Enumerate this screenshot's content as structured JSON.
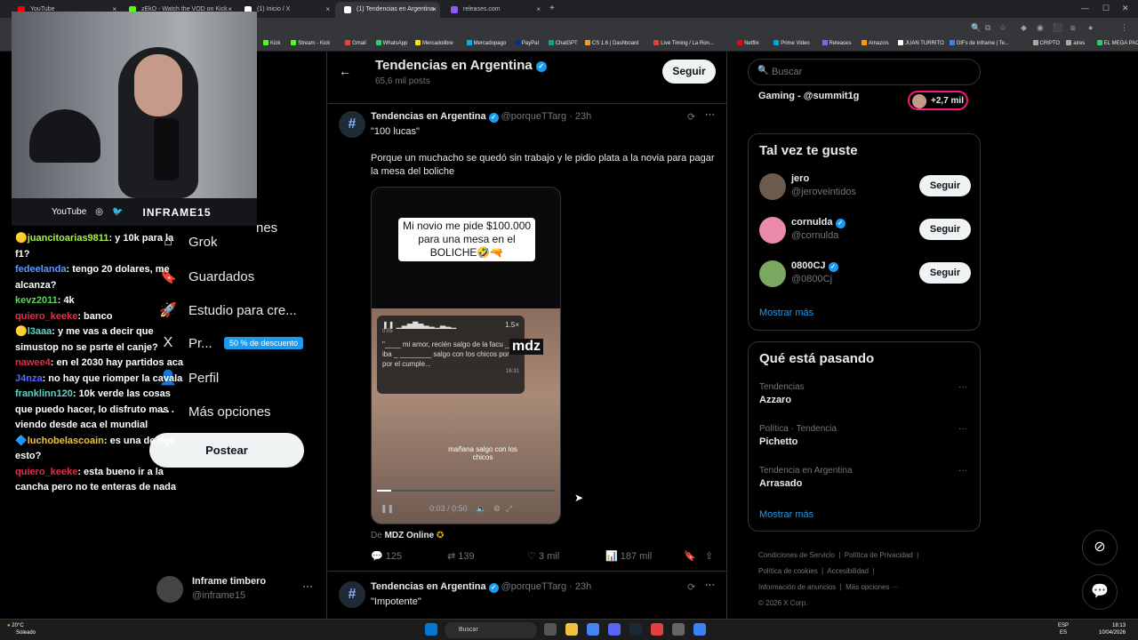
{
  "browser": {
    "tabs": [
      {
        "label": "YouTube",
        "color": "#ff0000"
      },
      {
        "label": "zEkO - Watch the VOD on Kick",
        "color": "#53fc18"
      },
      {
        "label": "(1) Inicio / X",
        "color": "#ffffff"
      },
      {
        "label": "(1) Tendencias en Argentina",
        "color": "#ffffff"
      },
      {
        "label": "releases.com",
        "color": "#8b5cf6"
      }
    ],
    "bookmarks": [
      "Kick",
      "Stream - Kick",
      "Gmail",
      "WhatsApp",
      "Mercadolibre",
      "Mercadopago",
      "PayPal",
      "ChatGPT",
      "CS 1.6 | Dashboard",
      "Live Timing / La Ron...",
      "Netflix",
      "Prime Video",
      "Releases",
      "Amazon.",
      "JUAN TURRITO",
      "GIFs de Inframe | Te...",
      "CRIPTO",
      "aires",
      "EL MEGA PACK PAR..."
    ]
  },
  "stream_overlay": {
    "socials": [
      "YouTube",
      "◎",
      "🐦"
    ],
    "brand": "INFRAME15"
  },
  "chat": [
    {
      "badge": "🟡",
      "user": "juancitoarias9811",
      "color": "#a7f046",
      "text": ": y 10k para la f1?"
    },
    {
      "badge": "",
      "user": "fedeelanda",
      "color": "#5b9bff",
      "text": ": tengo 20 dolares, me alcanza?"
    },
    {
      "badge": "",
      "user": "kevz2011",
      "color": "#5ad85a",
      "text": ": 4k"
    },
    {
      "badge": "",
      "user": "quiero_keeke",
      "color": "#e0304a",
      "text": ": banco"
    },
    {
      "badge": "🟡",
      "user": "l3aaa",
      "color": "#5ad8c8",
      "text": ": y me vas a decir que simustop no se psrte el canje?"
    },
    {
      "badge": "",
      "user": "nawee4",
      "color": "#e0304a",
      "text": ": en el 2030 hay partidos aca"
    },
    {
      "badge": "",
      "user": "J4nza",
      "color": "#5b6bff",
      "text": ": no hay que riomper la cavala"
    },
    {
      "badge": "",
      "user": "franklinn120",
      "color": "#5ad8c8",
      "text": ": 10k verde las cosas que puedo hacer, lo disfruto mas viendo desde aca el mundial"
    },
    {
      "badge": "🔷",
      "user": "luchobelascoain",
      "color": "#f0c040",
      "text": ": es una de dgo esto?"
    },
    {
      "badge": "",
      "user": "quiero_keeke",
      "color": "#e0304a",
      "text": ": esta bueno ir a la cancha pero no te enteras de nada"
    }
  ],
  "leftnav": {
    "items": [
      {
        "icon": "⌂",
        "label": "Grok"
      },
      {
        "icon": "🔖",
        "label": "Guardados"
      },
      {
        "icon": "🚀",
        "label": "Estudio para cre..."
      },
      {
        "icon": "X",
        "label": "Pr..."
      },
      {
        "icon": "👤",
        "label": "Perfil"
      },
      {
        "icon": "⋯",
        "label": "Más opciones"
      }
    ],
    "partial_label": "nes",
    "premium_badge": "50 % de descuento",
    "post_label": "Postear",
    "account": {
      "name": "Inframe timbero",
      "handle": "@inframe15"
    }
  },
  "main": {
    "title": "Tendencias en Argentina",
    "subtitle": "65,6 mil posts",
    "follow_label": "Seguir",
    "tweet1": {
      "name": "Tendencias en Argentina",
      "meta": "@porqueTTarg · 23h",
      "title": "\"100 lucas\"",
      "body": "Porque un muchacho se quedó sin trabajo y le pidio plata a la novia para pagar la mesa del boliche",
      "media_caption": "Mi novio me pide $100.000 para una mesa en el BOLICHE🤣🔫",
      "audio_speed": "1.5×",
      "audio_time": "0:05",
      "audio_text": "\"____ mi amor, recién salgo de la facu __ iba _ ________ salgo con los chicos por por el cumple...",
      "audio_time2": "16:31",
      "mdz": "mdz",
      "video_sub": "mañana salgo con los chicos",
      "video_time": "0:03 / 0:50",
      "progress": 0.08,
      "source_prefix": "De",
      "source": "MDZ Online",
      "stats": {
        "replies": "125",
        "reposts": "139",
        "likes": "3 mil",
        "views": "187 mil"
      }
    },
    "tweet2": {
      "name": "Tendencias en Argentina",
      "meta": "@porqueTTarg · 23h",
      "title": "\"Impotente\""
    }
  },
  "right": {
    "search_placeholder": "Buscar",
    "live": {
      "title": "Gaming - @summit1g",
      "count": "+2,7 mil"
    },
    "suggestions_title": "Tal vez te guste",
    "suggestions": [
      {
        "name": "jero",
        "handle": "@jeroveintidos",
        "verified": false,
        "color": "#6b5a4e"
      },
      {
        "name": "cornulda",
        "handle": "@cornulda",
        "verified": true,
        "color": "#e88aa8"
      },
      {
        "name": "0800CJ",
        "handle": "@0800Cj",
        "verified": true,
        "color": "#7aa860"
      }
    ],
    "follow_label": "Seguir",
    "show_more": "Mostrar más",
    "trends_title": "Qué está pasando",
    "trends": [
      {
        "context": "Tendencias",
        "topic": "Azzaro"
      },
      {
        "context": "Política · Tendencia",
        "topic": "Pichetto"
      },
      {
        "context": "Tendencia en Argentina",
        "topic": "Arrasado"
      }
    ],
    "footer": [
      "Condiciones de Servicio",
      "Política de Privacidad",
      "Política de cookies",
      "Accesibilidad",
      "Información de anuncios",
      "Más opciones ···",
      "© 2026 X Corp."
    ]
  },
  "taskbar": {
    "temp": "20°C",
    "weather": "Soleado",
    "search": "Buscar",
    "lang1": "ESP",
    "lang2": "ES",
    "time": "18:13",
    "date": "10/04/2026"
  }
}
